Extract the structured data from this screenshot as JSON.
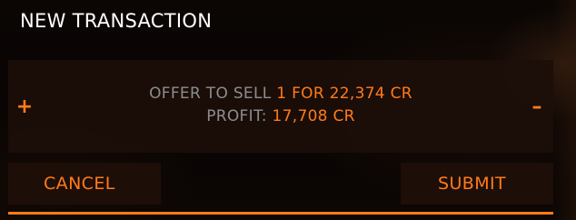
{
  "dialog": {
    "title": "NEW TRANSACTION"
  },
  "offer": {
    "increase_symbol": "+",
    "decrease_symbol": "–",
    "offer_label": "OFFER TO SELL",
    "quantity_price": "1 FOR 22,374 CR",
    "profit_label": "PROFIT:",
    "profit_value": "17,708 CR"
  },
  "actions": {
    "cancel_label": "CANCEL",
    "submit_label": "SUBMIT"
  },
  "colors": {
    "accent": "#ff7b1a",
    "muted_text": "#8d8d8d",
    "title_text": "#ffffff",
    "panel_bg": "#1c0e09"
  }
}
